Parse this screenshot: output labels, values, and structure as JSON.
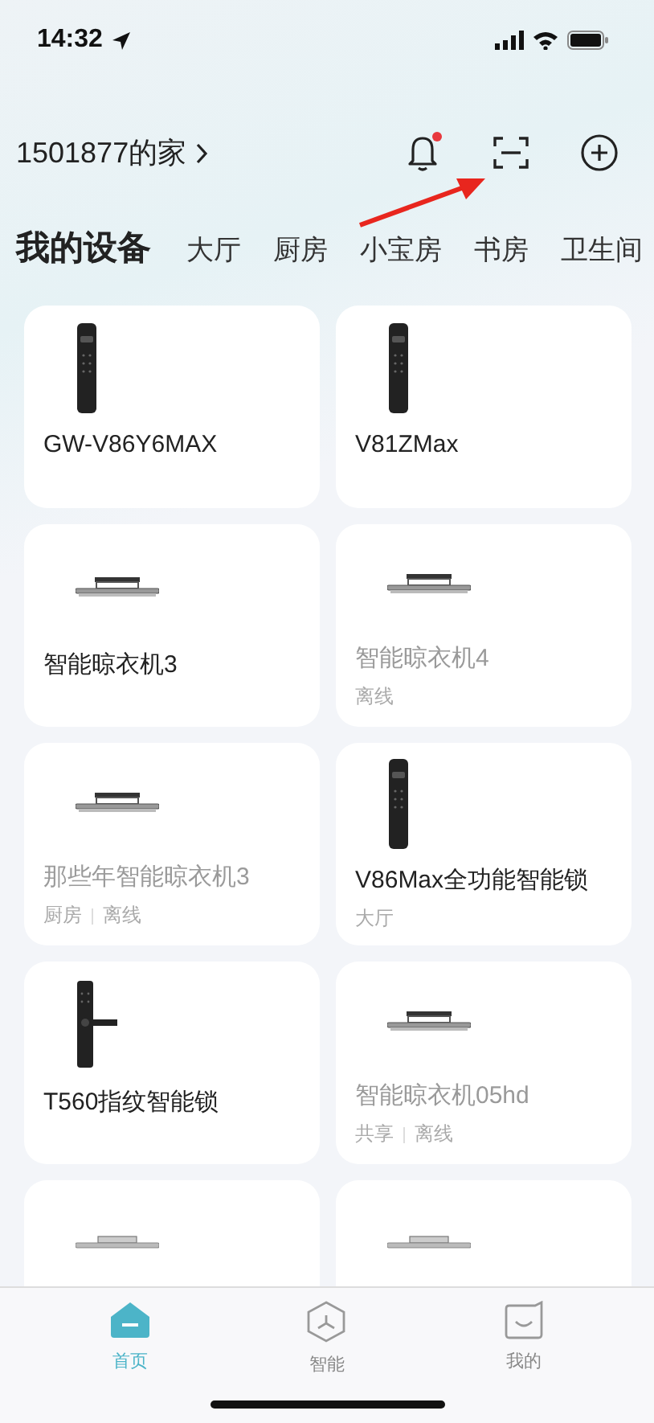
{
  "status_bar": {
    "time": "14:32"
  },
  "header": {
    "home_name": "1501877的家",
    "notification_unread": true
  },
  "room_tabs": [
    {
      "label": "我的设备",
      "selected": true
    },
    {
      "label": "大厅",
      "selected": false
    },
    {
      "label": "厨房",
      "selected": false
    },
    {
      "label": "小宝房",
      "selected": false
    },
    {
      "label": "书房",
      "selected": false
    },
    {
      "label": "卫生间",
      "selected": false
    }
  ],
  "devices": [
    {
      "kind": "lock",
      "name": "GW-V86Y6MAX",
      "offline": false
    },
    {
      "kind": "lock",
      "name": "V81ZMax",
      "offline": false
    },
    {
      "kind": "hanger",
      "name": "智能晾衣机3",
      "offline": false
    },
    {
      "kind": "hanger",
      "name": "智能晾衣机4",
      "offline": true,
      "meta": [
        "离线"
      ]
    },
    {
      "kind": "hanger",
      "name": "那些年智能晾衣机3",
      "offline": true,
      "meta": [
        "厨房",
        "离线"
      ]
    },
    {
      "kind": "lock",
      "name": "V86Max全功能智能锁",
      "offline": false,
      "meta": [
        "大厅"
      ]
    },
    {
      "kind": "handle-lock",
      "name": "T560指纹智能锁",
      "offline": false
    },
    {
      "kind": "hanger",
      "name": "智能晾衣机05hd",
      "offline": true,
      "meta": [
        "共享",
        "离线"
      ]
    },
    {
      "kind": "hanger-flat"
    },
    {
      "kind": "hanger-flat"
    }
  ],
  "bottom_nav": [
    {
      "kind": "home",
      "label": "首页",
      "selected": true
    },
    {
      "kind": "smart",
      "label": "智能",
      "selected": false
    },
    {
      "kind": "profile",
      "label": "我的",
      "selected": false
    }
  ]
}
